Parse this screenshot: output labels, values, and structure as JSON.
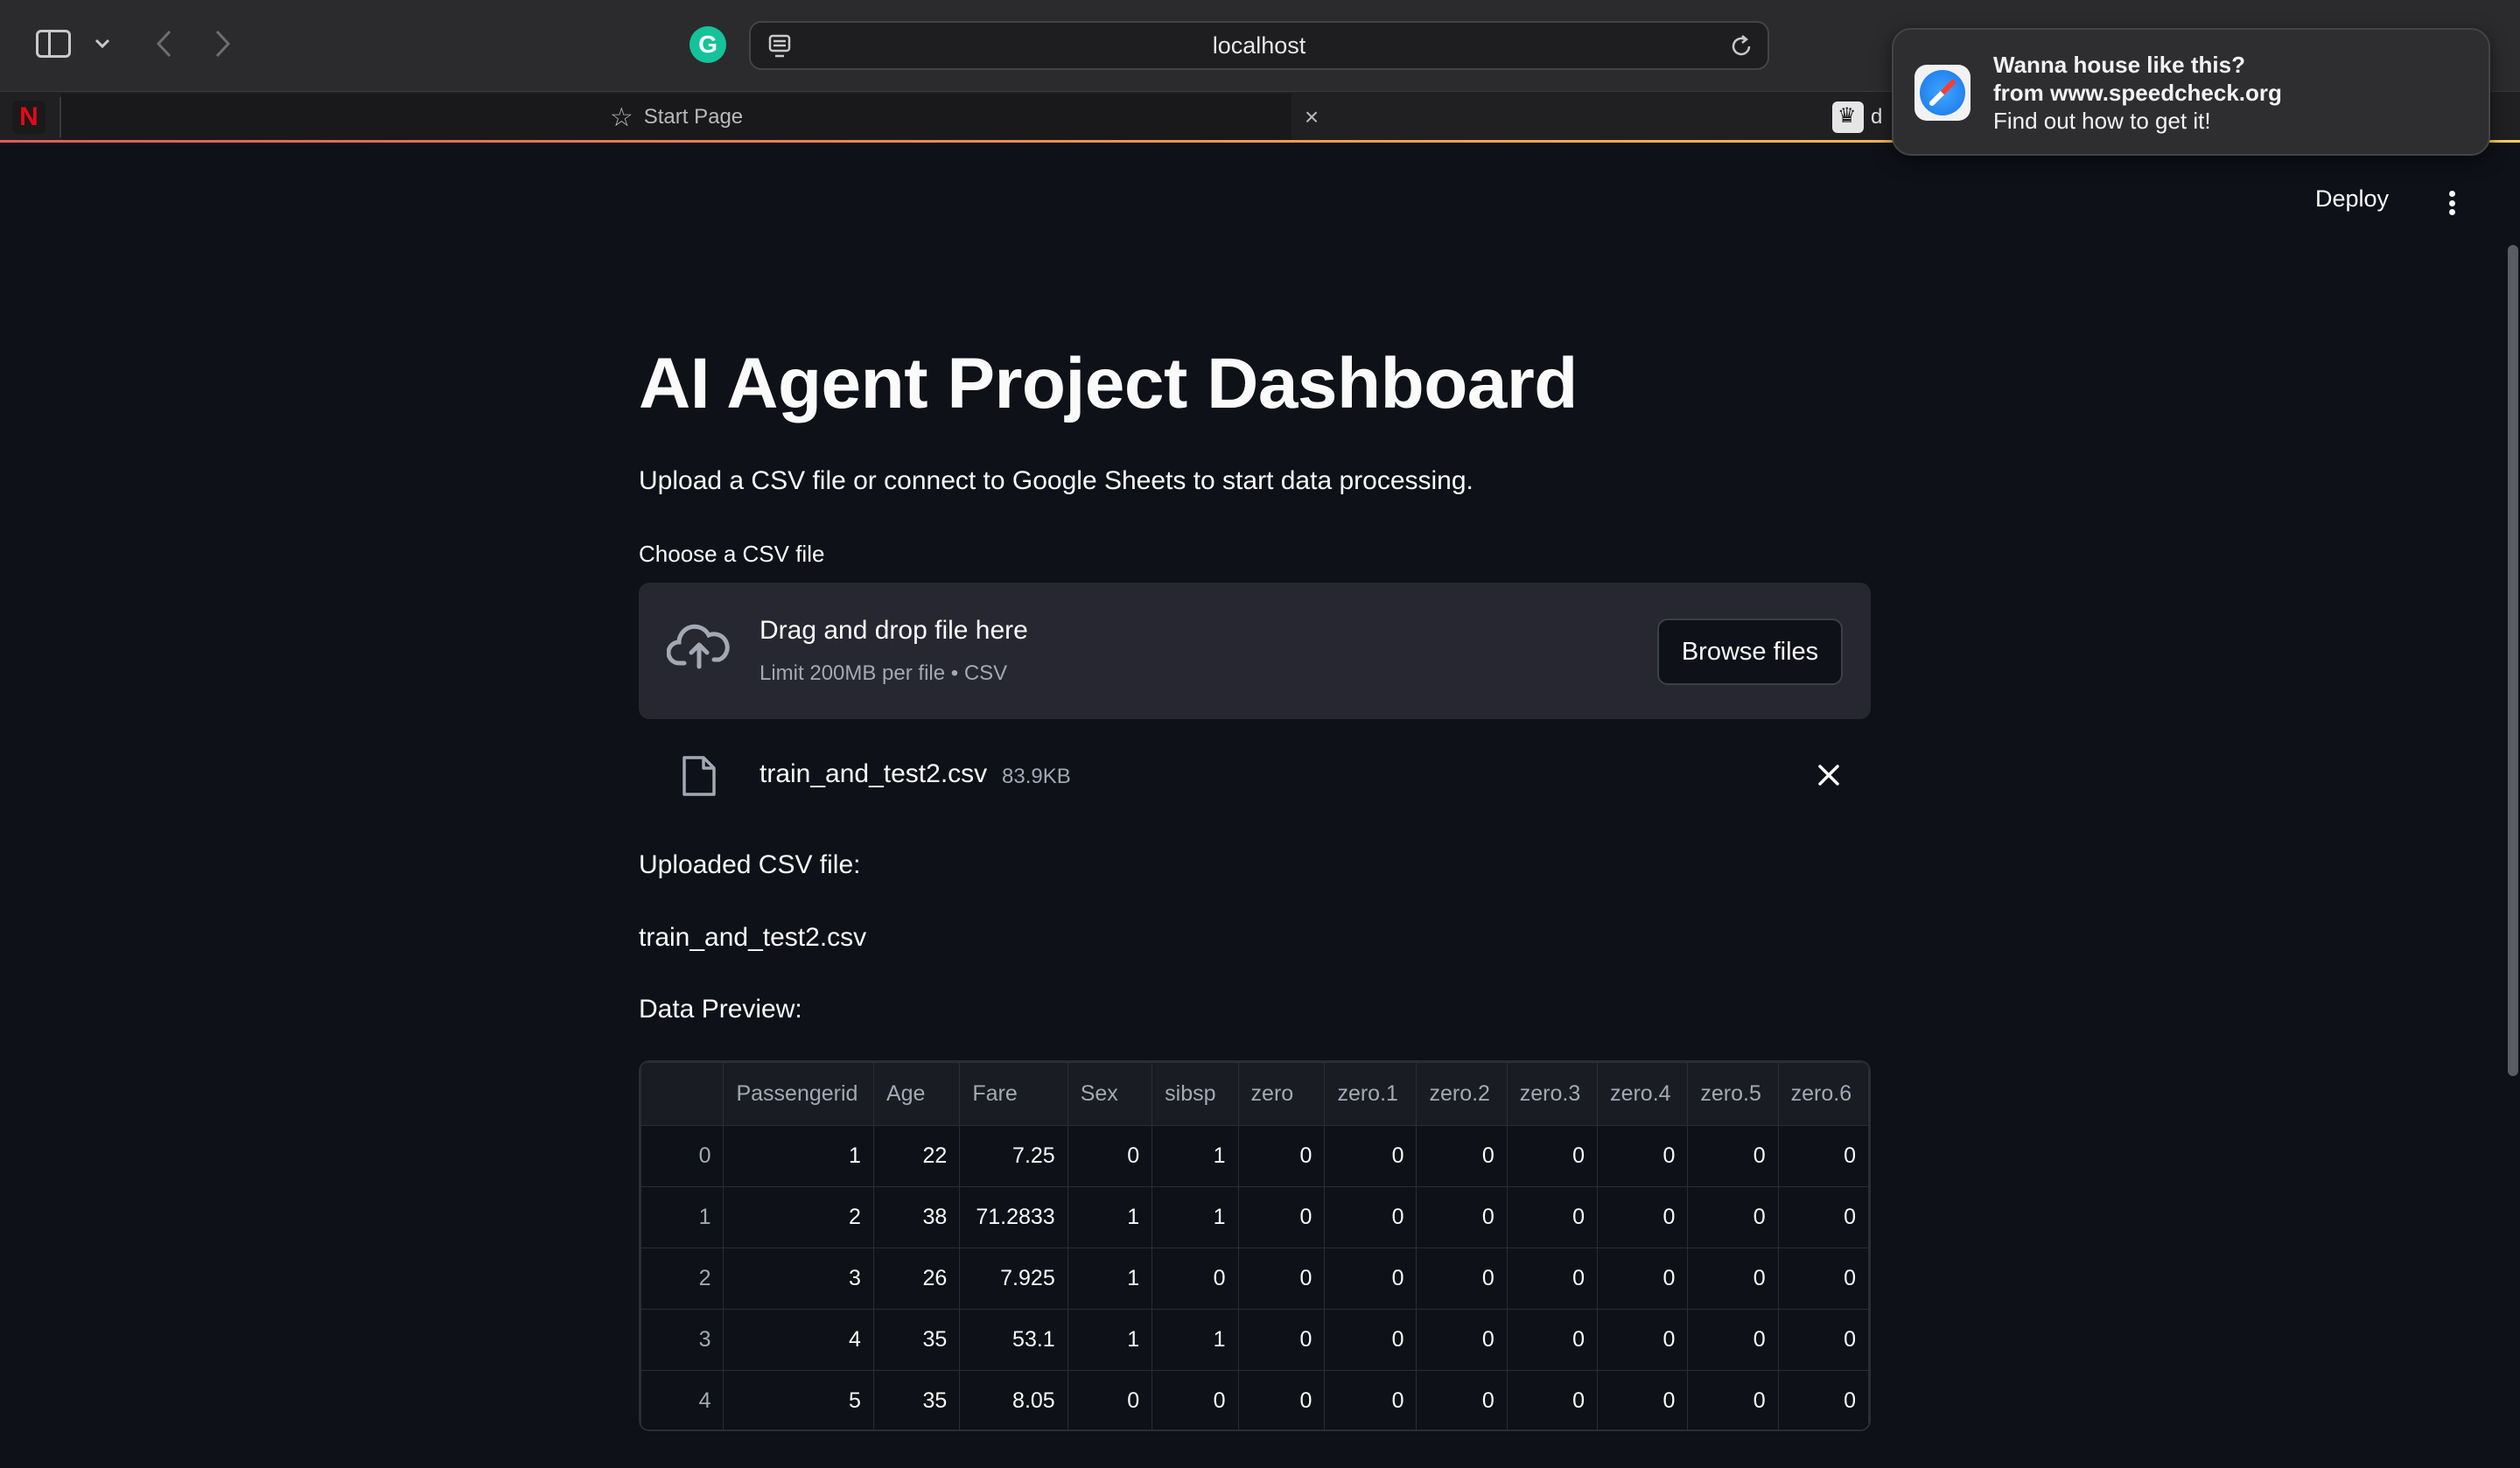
{
  "browser": {
    "address": "localhost",
    "tabs": [
      {
        "label": "Start Page"
      },
      {
        "label": "d"
      }
    ],
    "netflix_glyph": "N",
    "grammarly_glyph": "G",
    "tab_close_glyph": "×",
    "star_glyph": "☆"
  },
  "notification": {
    "title": "Wanna house like this?",
    "subtitle": "from www.speedcheck.org",
    "body": "Find out how to get it!"
  },
  "app": {
    "deploy_label": "Deploy",
    "title": "AI Agent Project Dashboard",
    "intro": "Upload a CSV file or connect to Google Sheets to start data processing.",
    "uploader": {
      "label": "Choose a CSV file",
      "drop_title": "Drag and drop file here",
      "limit": "Limit 200MB per file • CSV",
      "browse_label": "Browse files"
    },
    "file": {
      "name": "train_and_test2.csv",
      "size": "83.9KB"
    },
    "uploaded_label": "Uploaded CSV file:",
    "uploaded_name": "train_and_test2.csv",
    "preview_label": "Data Preview:",
    "table": {
      "columns": [
        "",
        "Passengerid",
        "Age",
        "Fare",
        "Sex",
        "sibsp",
        "zero",
        "zero.1",
        "zero.2",
        "zero.3",
        "zero.4",
        "zero.5",
        "zero.6"
      ],
      "rows": [
        [
          "0",
          "1",
          "22",
          "7.25",
          "0",
          "1",
          "0",
          "0",
          "0",
          "0",
          "0",
          "0",
          "0"
        ],
        [
          "1",
          "2",
          "38",
          "71.2833",
          "1",
          "1",
          "0",
          "0",
          "0",
          "0",
          "0",
          "0",
          "0"
        ],
        [
          "2",
          "3",
          "26",
          "7.925",
          "1",
          "0",
          "0",
          "0",
          "0",
          "0",
          "0",
          "0",
          "0"
        ],
        [
          "3",
          "4",
          "35",
          "53.1",
          "1",
          "1",
          "0",
          "0",
          "0",
          "0",
          "0",
          "0",
          "0"
        ],
        [
          "4",
          "5",
          "35",
          "8.05",
          "0",
          "0",
          "0",
          "0",
          "0",
          "0",
          "0",
          "0",
          "0"
        ]
      ]
    }
  },
  "colors": {
    "background": "#0e1117",
    "dropzone": "#262730",
    "text": "#fafafa",
    "muted": "#a3a8b4"
  }
}
